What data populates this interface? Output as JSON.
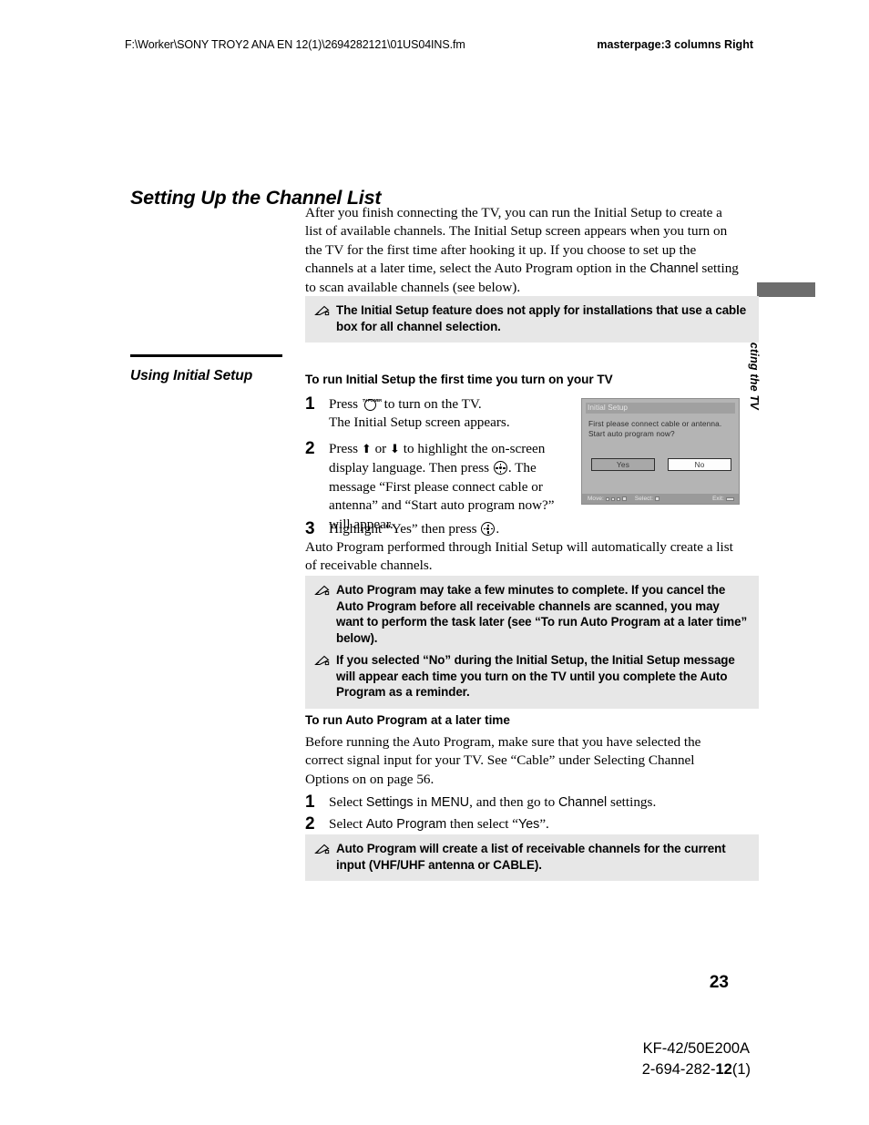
{
  "header": {
    "file_path": "F:\\Worker\\SONY TROY2 ANA EN 12(1)\\2694282121\\01US04INS.fm",
    "masterpage": "masterpage:3 columns Right"
  },
  "side_tab": {
    "label": "Connecting the TV"
  },
  "title": "Setting Up the Channel List",
  "intro": {
    "part1": "After you finish connecting the TV, you can run the Initial Setup to create a list of available channels. The Initial Setup screen appears when you turn on the TV for the first time after hooking it up. If you choose to set up the channels at a later time, select the Auto Program option in the ",
    "ui_channel": "Channel",
    "part2": " setting to scan available channels (see below)."
  },
  "notes": {
    "note1": "The Initial Setup feature does not apply for installations that use a cable box for all channel selection.",
    "note2": "Auto Program may take a few minutes to complete. If you cancel the Auto Program before all receivable channels are scanned, you may want to perform the task later (see “To run Auto Program at a later time” below).",
    "note3": "If you selected “No” during the Initial Setup, the Initial Setup message will appear each time you turn on the TV until you complete the Auto Program as a reminder.",
    "note4": "Auto Program will create a list of receivable channels for the current input (VHF/UHF antenna or CABLE).",
    "icon": "pen-note-icon"
  },
  "section": {
    "heading": "Using Initial Setup",
    "procedure_heading": "To run Initial Setup the first time you turn on your TV",
    "steps": [
      {
        "num": "1",
        "key_label": "TV POWER",
        "text_before_key": "Press ",
        "text_after_key": " to turn on the TV.",
        "line2": "The Initial Setup screen appears."
      },
      {
        "num": "2",
        "seg1": "Press ",
        "arrow_up": "⬆",
        "seg2": " or ",
        "arrow_down": "⬇",
        "seg3": " to highlight the on-screen display language. Then press ",
        "seg4": ". The message “First please connect cable or antenna” and “Start auto program now?” will appear."
      },
      {
        "num": "3",
        "seg1": "Highlight “Yes” then press ",
        "seg2": "."
      }
    ],
    "after_steps": "Auto Program performed through Initial Setup will automatically create a list of receivable channels."
  },
  "later_section": {
    "heading": "To run Auto Program at a later time",
    "paragraph": "Before running the Auto Program, make sure that you have selected the correct signal input for your TV. See “Cable” under Selecting Channel Options on on page 56.",
    "steps": [
      {
        "num": "1",
        "seg1": "Select ",
        "ui1": "Settings",
        "seg2": " in ",
        "ui2": "MENU",
        "seg3": ", and then go to ",
        "ui3": "Channel",
        "seg4": " settings."
      },
      {
        "num": "2",
        "seg1": "Select ",
        "ui1": "Auto Program",
        "seg2": " then select “",
        "ui2": "Yes",
        "seg3": "”."
      }
    ]
  },
  "tv_screen": {
    "title": "Initial Setup",
    "message_line1": "First please connect cable or antenna.",
    "message_line2": "Start auto program now?",
    "button_yes": "Yes",
    "button_no": "No",
    "status_move": "Move:",
    "status_select": "Select:",
    "status_exit": "Exit:"
  },
  "footer": {
    "page_number": "23",
    "model": "KF-42/50E200A",
    "part_prefix": "2-694-282-",
    "part_bold": "12",
    "part_suffix": "(1)"
  },
  "colors": {
    "note_background": "#e7e7e7",
    "thumb_tab": "#6d6d6d",
    "tv_screen_bg": "#b4b4b4"
  }
}
